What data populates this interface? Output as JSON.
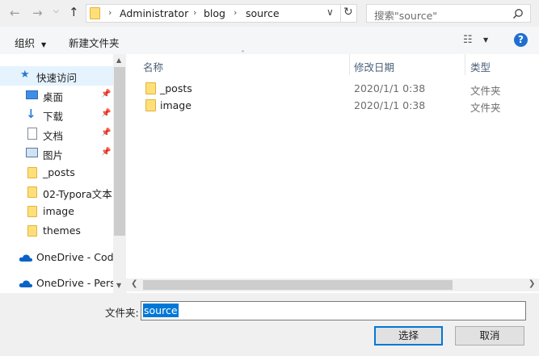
{
  "nav": {
    "back_icon": "arrow-left-icon",
    "forward_icon": "arrow-right-icon",
    "dropdown_icon": "chevron-down-icon",
    "up_icon": "arrow-up-icon"
  },
  "address": {
    "crumbs": [
      "Administrator",
      "blog",
      "source"
    ],
    "refresh_icon": "refresh-icon"
  },
  "search": {
    "placeholder": "搜索\"source\"",
    "icon": "search-icon"
  },
  "toolbar": {
    "organize_label": "组织",
    "new_folder_label": "新建文件夹",
    "help_label": "?"
  },
  "sidebar": {
    "items": [
      {
        "label": "快速访问",
        "icon": "star-icon"
      },
      {
        "label": "桌面",
        "icon": "desktop-icon",
        "pinned": true
      },
      {
        "label": "下载",
        "icon": "download-icon",
        "pinned": true
      },
      {
        "label": "文档",
        "icon": "document-icon",
        "pinned": true
      },
      {
        "label": "图片",
        "icon": "picture-icon",
        "pinned": true
      },
      {
        "label": "_posts",
        "icon": "folder-icon"
      },
      {
        "label": "02-Typora文本",
        "icon": "folder-icon"
      },
      {
        "label": "image",
        "icon": "folder-icon"
      },
      {
        "label": "themes",
        "icon": "folder-icon"
      },
      {
        "label": "OneDrive - Code",
        "icon": "cloud-icon"
      },
      {
        "label": "OneDrive - Perso",
        "icon": "cloud-icon"
      }
    ]
  },
  "list": {
    "columns": [
      "名称",
      "修改日期",
      "类型"
    ],
    "rows": [
      {
        "name": "_posts",
        "date": "2020/1/1 0:38",
        "type": "文件夹"
      },
      {
        "name": "image",
        "date": "2020/1/1 0:38",
        "type": "文件夹"
      }
    ]
  },
  "footer": {
    "folder_label": "文件夹:",
    "folder_value": "source",
    "select_label": "选择",
    "cancel_label": "取消"
  },
  "colors": {
    "accent": "#0078d7",
    "selected_bg": "#cce8ff",
    "folder": "#ffdf7a",
    "onedrive": "#0a64c8"
  }
}
